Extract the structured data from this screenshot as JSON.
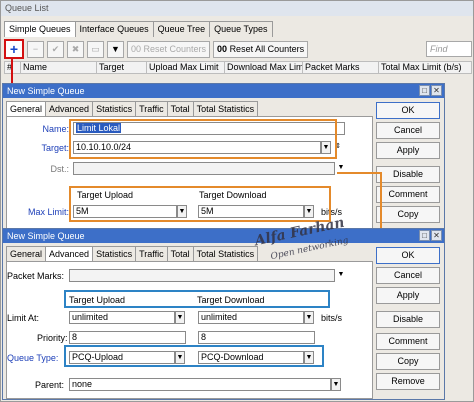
{
  "queue_list": {
    "title": "Queue List",
    "tabs": [
      "Simple Queues",
      "Interface Queues",
      "Queue Tree",
      "Queue Types"
    ],
    "toolbar": {
      "add": "+",
      "reset_counters": "Reset Counters",
      "reset_all_counters": "Reset All Counters",
      "find_placeholder": "Find"
    },
    "columns": [
      "#",
      "Name",
      "Target",
      "Upload Max Limit",
      "Download Max Limit",
      "Packet Marks",
      "Total Max Limit (b/s)"
    ]
  },
  "dialog_general": {
    "title": "New Simple Queue",
    "tabs": [
      "General",
      "Advanced",
      "Statistics",
      "Traffic",
      "Total",
      "Total Statistics"
    ],
    "name_label": "Name:",
    "name_value": "Limit Lokal",
    "target_label": "Target:",
    "target_value": "10.10.10.0/24",
    "dst_label": "Dst.:",
    "target_upload_label": "Target Upload",
    "target_download_label": "Target Download",
    "max_limit_label": "Max Limit:",
    "upload_value": "5M",
    "download_value": "5M",
    "unit": "bits/s",
    "buttons": [
      "OK",
      "Cancel",
      "Apply",
      "Disable",
      "Comment",
      "Copy"
    ]
  },
  "dialog_advanced": {
    "title": "New Simple Queue",
    "tabs": [
      "General",
      "Advanced",
      "Statistics",
      "Traffic",
      "Total",
      "Total Statistics"
    ],
    "packet_marks_label": "Packet Marks:",
    "target_upload_label": "Target Upload",
    "target_download_label": "Target Download",
    "limit_at_label": "Limit At:",
    "limit_at_upload": "unlimited",
    "limit_at_download": "unlimited",
    "unit": "bits/s",
    "priority_label": "Priority:",
    "priority_upload": "8",
    "priority_download": "8",
    "queue_type_label": "Queue Type:",
    "queue_type_upload": "PCQ-Upload",
    "queue_type_download": "PCQ-Download",
    "parent_label": "Parent:",
    "parent_value": "none",
    "buttons": [
      "OK",
      "Cancel",
      "Apply",
      "Disable",
      "Comment",
      "Copy",
      "Remove"
    ]
  },
  "watermark": {
    "name": "Alfa Farhan",
    "tagline": "Open networking"
  },
  "colors": {
    "title_bar": "#3d6fc8",
    "highlight_orange": "#e48a2b",
    "highlight_blue": "#2d83c5",
    "arrow_red": "#d31010",
    "label_blue": "#1d3fb8"
  }
}
